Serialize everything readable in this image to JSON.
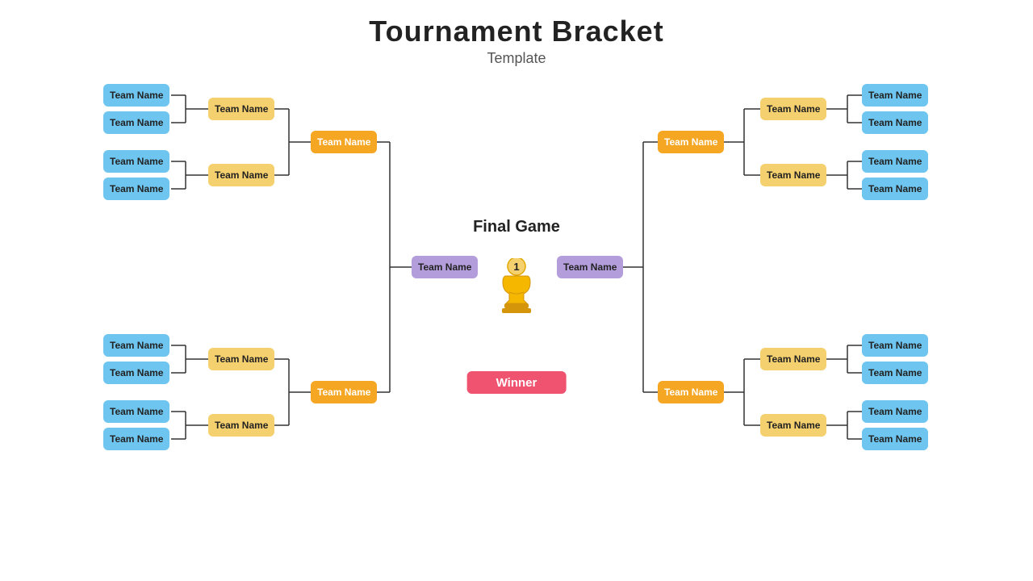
{
  "title": "Tournament Bracket",
  "subtitle": "Template",
  "center": {
    "final_game_label": "Final Game",
    "winner_label": "Winner"
  },
  "teams": {
    "l1_1": "Team Name",
    "l1_2": "Team Name",
    "l1_3": "Team Name",
    "l1_4": "Team Name",
    "l2_1": "Team Name",
    "l2_2": "Team Name",
    "l3_1": "Team Name",
    "l4_1": "Team Name",
    "l4_2": "Team Name",
    "l4_3": "Team Name",
    "l4_4": "Team Name",
    "l5_1": "Team Name",
    "l5_2": "Team Name",
    "l6_1": "Team Name",
    "finalist_left": "Team Name",
    "r1_1": "Team Name",
    "r1_2": "Team Name",
    "r1_3": "Team Name",
    "r1_4": "Team Name",
    "r2_1": "Team Name",
    "r2_2": "Team Name",
    "r3_1": "Team Name",
    "r4_1": "Team Name",
    "r4_2": "Team Name",
    "r4_3": "Team Name",
    "r4_4": "Team Name",
    "r5_1": "Team Name",
    "r5_2": "Team Name",
    "r6_1": "Team Name",
    "finalist_right": "Team Name"
  }
}
